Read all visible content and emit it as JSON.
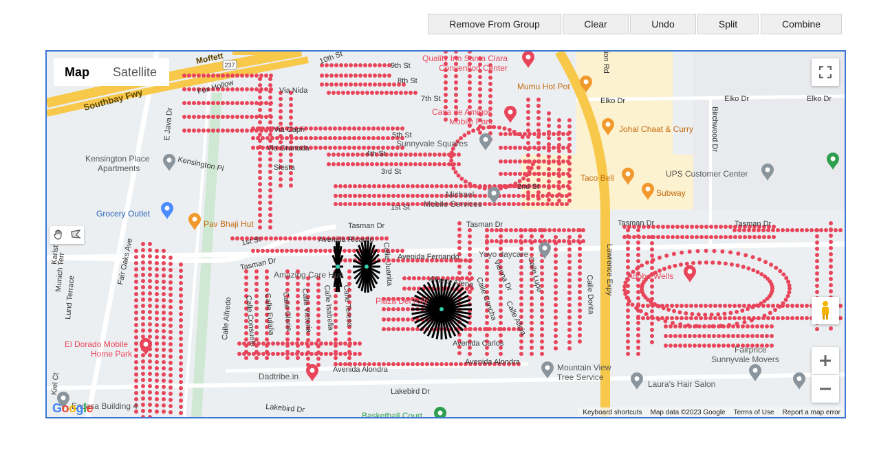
{
  "toolbar": {
    "remove_label": "Remove From Group",
    "clear_label": "Clear",
    "undo_label": "Undo",
    "split_label": "Split",
    "combine_label": "Combine"
  },
  "map": {
    "type_map": "Map",
    "type_satellite": "Satellite",
    "google_logo": "Google",
    "attribution": {
      "shortcuts": "Keyboard shortcuts",
      "data": "Map data ©2023 Google",
      "terms": "Terms of Use",
      "report": "Report a map error"
    },
    "highways": {
      "southbay": "Southbay Fwy",
      "moffett": "Moffett",
      "route": "237",
      "lawrence": "Lawrence Expy"
    },
    "streets": {
      "tasman": "Tasman Dr",
      "lakebird": "Lakebird Dr",
      "elko": "Elko Dr",
      "birchwood": "Birchwood Dr",
      "avenida_alondra": "Avenida Alondra",
      "avenida_carlos": "Avenida Carlos",
      "avenida_fernando": "Avenida Fernando",
      "avenida_ricardo": "Avenida Ricardo",
      "afuera_arena": "Afuera Arena",
      "first_st": "1st St",
      "second_st": "2nd St",
      "third_st": "3rd St",
      "fourth_st": "4th St",
      "fifth_st": "5th St",
      "seventh_st": "7th St",
      "eighth_st": "8th St",
      "ninth_st": "9th St",
      "tenth_st": "10th St",
      "kensington_pl": "Kensington Pl",
      "via_nida": "Via Nida",
      "via_capri": "Via Capri",
      "via_granada": "Via Granada",
      "siesta": "Siesta",
      "fox_hollow": "Fox Hollow",
      "fair_oaks": "Fair Oaks Ave",
      "e_java": "E Java Dr",
      "lund": "Lund Terrace",
      "munich": "Munich Terr",
      "karlst": "Karlst",
      "kiel": "Kiel Ct",
      "calle_alfredo": "Calle Alfredo",
      "calle_consuelo": "Calle Consuelo",
      "calle_eulalia": "Calle Eulalia",
      "calle_gloria": "Calle Gloria",
      "calle_victoria": "Calle Victoria",
      "calle_isabella": "Calle Isabella",
      "calle_teresa": "Calle Teresa",
      "calle_juanita": "Calle Juanita",
      "calle_dorita": "Calle Dorita",
      "calle_lupe": "Calle Lupe",
      "calle_concha": "Calle Concha",
      "calle_alicia": "Calle Alicia",
      "vienna": "Vienna Dr",
      "ion_rd": "ion Rd"
    },
    "places": {
      "quality_inn": "Quality Inn Santa Clara",
      "quality_inn_2": "Convention Center",
      "mumu": "Mumu Hot Pot",
      "casa": "Casa de Amigos",
      "casa_2": "Mobile Park",
      "johal": "Johal Chaat & Curry",
      "sunnyvale_squares": "Sunnyvale Squares",
      "kensington_apts": "Kensington Place",
      "kensington_apts_2": "Apartments",
      "ups": "UPS Customer Center",
      "taco_bell": "Taco Bell",
      "subway": "Subway",
      "michael_mobile": "Michael",
      "michael_mobile_2": "Mobile Services",
      "grocery_outlet": "Grocery Outlet",
      "pav_bhaji": "Pav Bhaji Hut",
      "yoyo": "Yoyo daycare",
      "adobe_wells": "Adobe Wells",
      "amazing_care": "Amazing Care Hus",
      "plaza_del_rey": "Plaza Del Rey",
      "el_dorado": "El Dorado Mobile",
      "el_dorado_2": "Home Park",
      "mountain_view_tree": "Mountain View",
      "mountain_view_tree_2": "Tree Service",
      "lauras": "Laura's Hair Salon",
      "fairprice": "Fairprice",
      "sunnyvale_movers": "Sunnyvale Movers",
      "dadtribe": "Dadtribe.in",
      "encasa": "Encasa Building 4",
      "basketball": "Basketball Court"
    },
    "colors": {
      "dot": "#e8445a",
      "highway": "#f7c84a",
      "road": "#ffffff",
      "poi_red": "#e8445a",
      "poi_orange": "#f2992e",
      "poi_gray": "#8a949c",
      "poi_blue": "#4a8cff",
      "poi_green": "#2e9e4f",
      "frame": "#3b76d4"
    }
  }
}
